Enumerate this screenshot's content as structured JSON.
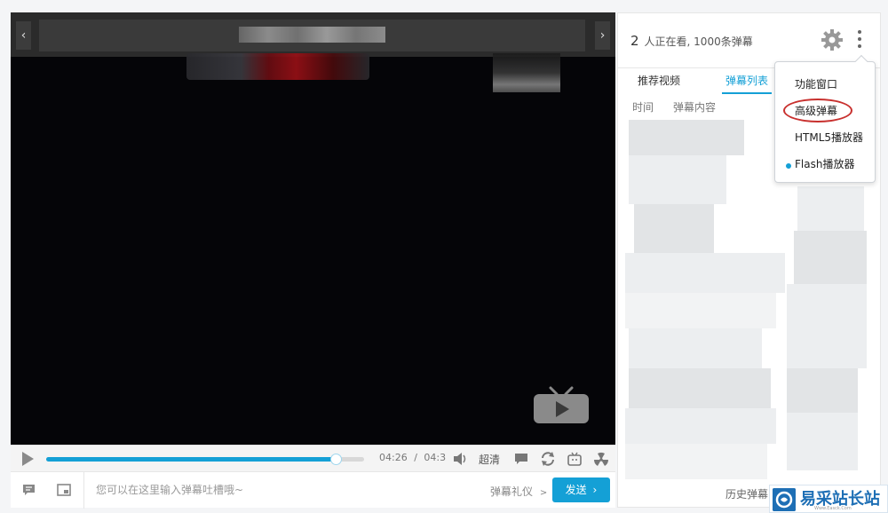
{
  "player": {
    "prev_arrow": "‹",
    "next_arrow": "›",
    "time_current": "04:26",
    "time_separator": "/",
    "time_total": "04:3",
    "progress": 0.91,
    "quality_label": "超清",
    "danmaku_placeholder": "您可以在这里输入弹幕吐槽哦~",
    "etiquette_label": "弹幕礼仪",
    "etiquette_arrow": ">",
    "send_label": "发送",
    "send_arrow": "›"
  },
  "panel": {
    "viewer_count": "2",
    "viewer_text": "人正在看, 1000条弹幕",
    "tabs": [
      {
        "label": "推荐视频"
      },
      {
        "label": "弹幕列表"
      }
    ],
    "columns": {
      "time": "时间",
      "content": "弹幕内容"
    },
    "history_label": "历史弹幕"
  },
  "menu": {
    "items": [
      {
        "label": "功能窗口"
      },
      {
        "label": "高级弹幕"
      },
      {
        "label": "HTML5播放器"
      },
      {
        "label": "Flash播放器"
      }
    ]
  },
  "watermark": {
    "text": "易采站长站",
    "sub": "Www.Easck.Com"
  },
  "colors": {
    "accent": "#14a0d6",
    "highlight_ring": "#c8302e",
    "watermark": "#1e6fb5"
  },
  "icons": [
    "chevron-left-icon",
    "chevron-right-icon",
    "tv-logo-icon",
    "play-icon",
    "volume-icon",
    "danmaku-toggle-icon",
    "loop-icon",
    "bilibili-icon",
    "radiation-icon",
    "chat-icon",
    "picture-in-picture-icon",
    "gear-icon",
    "more-vertical-icon"
  ]
}
